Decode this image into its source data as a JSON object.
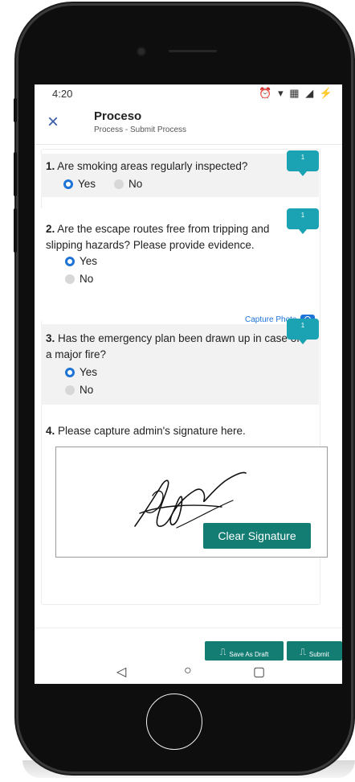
{
  "status_bar": {
    "time": "4:20",
    "icons": "⏰ ▾ ▦ ◢ ⚡"
  },
  "app_bar": {
    "title": "Proceso",
    "subtitle": "Process - Submit Process",
    "close_icon": "×"
  },
  "questions": [
    {
      "number": "1.",
      "text": " Are smoking areas regularly inspected?",
      "badge": "1",
      "options": [
        {
          "label": "Yes",
          "selected": true
        },
        {
          "label": "No",
          "selected": false
        }
      ]
    },
    {
      "number": "2.",
      "text": " Are the escape routes free from tripping and slipping hazards? Please provide evidence.",
      "badge": "1",
      "options": [
        {
          "label": "Yes",
          "selected": true
        },
        {
          "label": "No",
          "selected": false
        }
      ],
      "capture_label": "Capture Photo"
    },
    {
      "number": "3.",
      "text": " Has the emergency plan been drawn up in case of a major fire?",
      "badge": "1",
      "options": [
        {
          "label": "Yes",
          "selected": true
        },
        {
          "label": "No",
          "selected": false
        }
      ]
    },
    {
      "number": "4.",
      "text": " Please capture admin's signature here."
    }
  ],
  "signature": {
    "clear_label": "Clear Signature"
  },
  "footer": {
    "save_draft_label": "Save As Draft",
    "submit_label": "Submit"
  },
  "nav_bar": {
    "back_icon": "◁",
    "home_icon": "○",
    "recents_icon": "▢"
  },
  "colors": {
    "accent": "#1e73d6",
    "teal": "#137c73",
    "badge": "#1ba3b4"
  }
}
